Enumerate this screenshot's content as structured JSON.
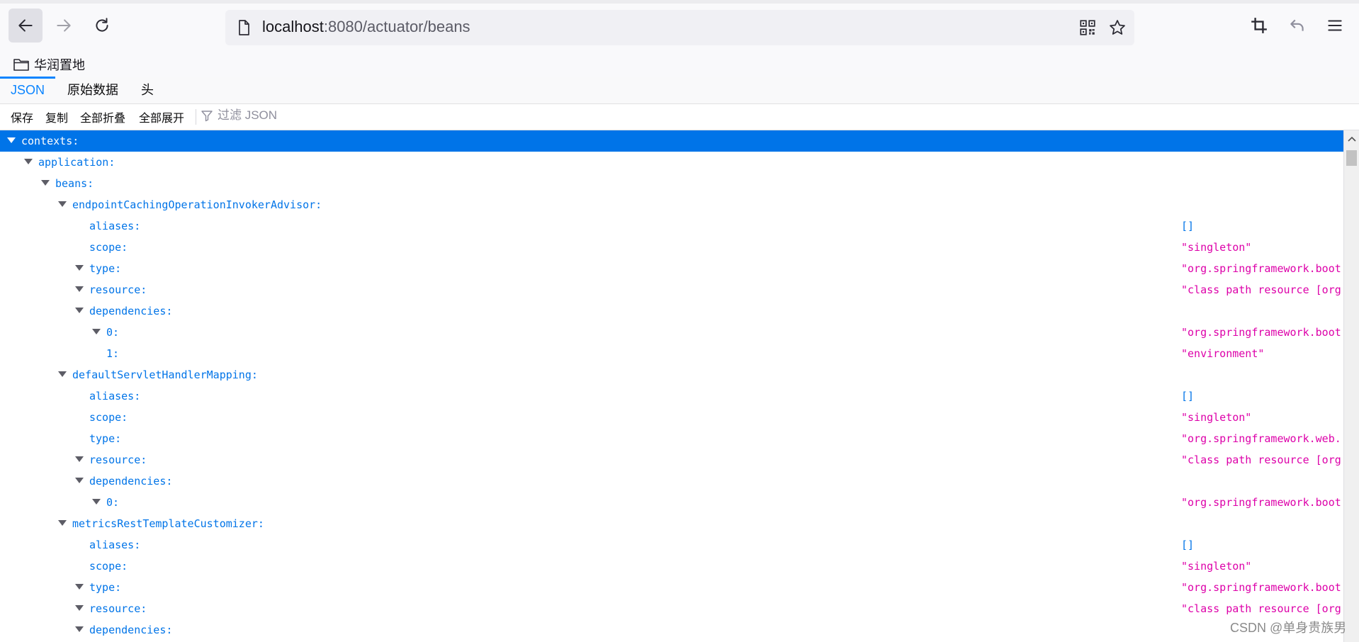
{
  "browser": {
    "url_host": "localhost",
    "url_rest": ":8080/actuator/beans",
    "icons": [
      "back-arrow-icon",
      "forward-arrow-icon",
      "reload-icon",
      "page-icon",
      "qr-code-icon",
      "star-icon",
      "crop-icon",
      "undo-icon",
      "menu-icon"
    ]
  },
  "bookmarks": {
    "items": [
      {
        "label": "华润置地",
        "icon": "folder-icon"
      }
    ]
  },
  "viewer": {
    "tabs": [
      "JSON",
      "原始数据",
      "头"
    ],
    "selected_tab": "JSON"
  },
  "json_toolbar": {
    "save": "保存",
    "copy": "复制",
    "collapse_all": "全部折叠",
    "expand_all": "全部展开",
    "filter_placeholder": "过滤 JSON"
  },
  "tree": {
    "rows": [
      {
        "key": "contexts:",
        "depth": 0,
        "toggle": true,
        "value": "",
        "kind": "none",
        "selected": true
      },
      {
        "key": "application:",
        "depth": 1,
        "toggle": true,
        "value": "",
        "kind": "none"
      },
      {
        "key": "beans:",
        "depth": 2,
        "toggle": true,
        "value": "",
        "kind": "none"
      },
      {
        "key": "endpointCachingOperationInvokerAdvisor:",
        "depth": 3,
        "toggle": true,
        "value": "",
        "kind": "none"
      },
      {
        "key": "aliases:",
        "depth": 4,
        "toggle": false,
        "value": "[]",
        "kind": "arr"
      },
      {
        "key": "scope:",
        "depth": 4,
        "toggle": false,
        "value": "\"singleton\"",
        "kind": "str"
      },
      {
        "key": "type:",
        "depth": 4,
        "toggle": true,
        "value": "\"org.springframework.boot",
        "kind": "str"
      },
      {
        "key": "resource:",
        "depth": 4,
        "toggle": true,
        "value": "\"class path resource [org",
        "kind": "str"
      },
      {
        "key": "dependencies:",
        "depth": 4,
        "toggle": true,
        "value": "",
        "kind": "none"
      },
      {
        "key": "0:",
        "depth": 5,
        "toggle": true,
        "value": "\"org.springframework.boot",
        "kind": "str"
      },
      {
        "key": "1:",
        "depth": 5,
        "toggle": false,
        "value": "\"environment\"",
        "kind": "str"
      },
      {
        "key": "defaultServletHandlerMapping:",
        "depth": 3,
        "toggle": true,
        "value": "",
        "kind": "none"
      },
      {
        "key": "aliases:",
        "depth": 4,
        "toggle": false,
        "value": "[]",
        "kind": "arr"
      },
      {
        "key": "scope:",
        "depth": 4,
        "toggle": false,
        "value": "\"singleton\"",
        "kind": "str"
      },
      {
        "key": "type:",
        "depth": 4,
        "toggle": false,
        "value": "\"org.springframework.web.",
        "kind": "str"
      },
      {
        "key": "resource:",
        "depth": 4,
        "toggle": true,
        "value": "\"class path resource [org",
        "kind": "str"
      },
      {
        "key": "dependencies:",
        "depth": 4,
        "toggle": true,
        "value": "",
        "kind": "none"
      },
      {
        "key": "0:",
        "depth": 5,
        "toggle": true,
        "value": "\"org.springframework.boot",
        "kind": "str"
      },
      {
        "key": "metricsRestTemplateCustomizer:",
        "depth": 3,
        "toggle": true,
        "value": "",
        "kind": "none"
      },
      {
        "key": "aliases:",
        "depth": 4,
        "toggle": false,
        "value": "[]",
        "kind": "arr"
      },
      {
        "key": "scope:",
        "depth": 4,
        "toggle": false,
        "value": "\"singleton\"",
        "kind": "str"
      },
      {
        "key": "type:",
        "depth": 4,
        "toggle": true,
        "value": "\"org.springframework.boot",
        "kind": "str"
      },
      {
        "key": "resource:",
        "depth": 4,
        "toggle": true,
        "value": "\"class path resource [org",
        "kind": "str"
      },
      {
        "key": "dependencies:",
        "depth": 4,
        "toggle": true,
        "value": "",
        "kind": "none"
      }
    ]
  },
  "watermark": "CSDN @单身贵族男",
  "colors": {
    "accent": "#0074e8",
    "string": "#dd00a9",
    "selection": "#0074e8"
  }
}
